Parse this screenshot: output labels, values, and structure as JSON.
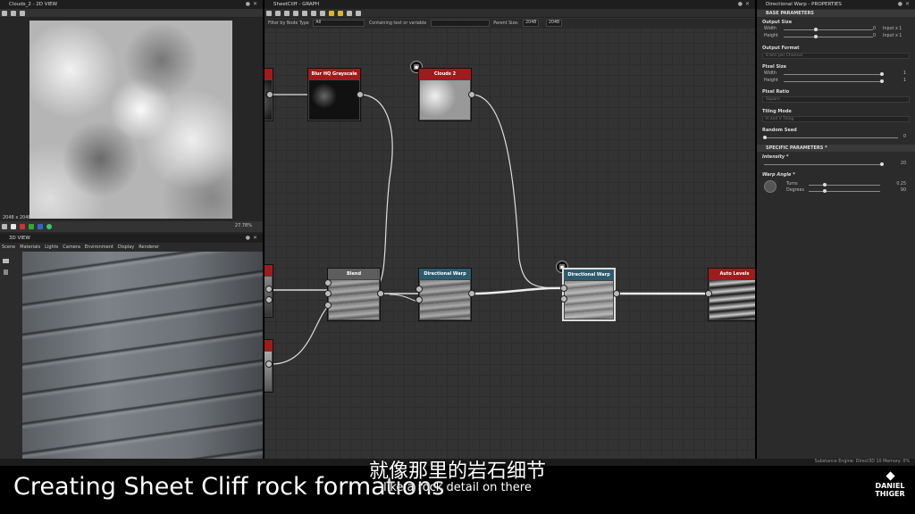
{
  "view2d": {
    "title": "Clouds_2 - 2D VIEW",
    "resolution": "2048 x 2048",
    "zoom": "27.78%"
  },
  "view3d": {
    "title": "3D VIEW",
    "menu": [
      "Scene",
      "Materials",
      "Lights",
      "Camera",
      "Environment",
      "Display",
      "Renderer"
    ]
  },
  "graph": {
    "title": "SheetCliff - GRAPH",
    "filter_label": "Filter by Node Type",
    "filter_value": "All",
    "search_label": "Containing text or variable",
    "parent_size_label": "Parent Size:",
    "parent_size_value": "2048",
    "size_value": "2048",
    "nodes": {
      "blur": "Blur HQ Grayscale",
      "clouds": "Clouds 2",
      "blend": "Blend",
      "warp1": "Directional Warp",
      "warp2": "Directional Warp",
      "autolevels": "Auto Levels"
    }
  },
  "properties": {
    "title": "Directional Warp - PROPERTIES",
    "base_header": "BASE PARAMETERS",
    "output_size": "Output Size",
    "width_label": "Width",
    "width_value": "0",
    "width_mode": "Input x 1",
    "height_label": "Height",
    "height_value": "0",
    "height_mode": "Input x 1",
    "output_format": "Output Format",
    "output_format_value": "8 bits per Channel",
    "pixel_size": "Pixel Size",
    "ps_width_label": "Width",
    "ps_width_value": "1",
    "ps_height_label": "Height",
    "ps_height_value": "1",
    "pixel_ratio": "Pixel Ratio",
    "pixel_ratio_value": "Square",
    "tiling_mode": "Tiling Mode",
    "tiling_value": "H and V Tiling",
    "random_seed": "Random Seed",
    "random_seed_value": "0",
    "specific_header": "SPECIFIC PARAMETERS *",
    "intensity_label": "Intensity *",
    "intensity_value": "20",
    "warp_angle_label": "Warp Angle *",
    "turns_label": "Turns",
    "turns_value": "0.25",
    "degrees_label": "Degrees",
    "degrees_value": "90"
  },
  "status": {
    "engine": "Substance Engine: Direct3D 10  Memory: 0%"
  },
  "caption": {
    "title": "Creating Sheet Cliff rock formations",
    "subtitle_cn": "就像那里的岩石细节",
    "subtitle_en": "like a rock detail on there",
    "logo_line1": "DANIEL",
    "logo_line2": "THIGER"
  },
  "colors": {
    "node_red": "#a01b1b",
    "node_blue": "#2e5a6e",
    "background": "#333333"
  }
}
